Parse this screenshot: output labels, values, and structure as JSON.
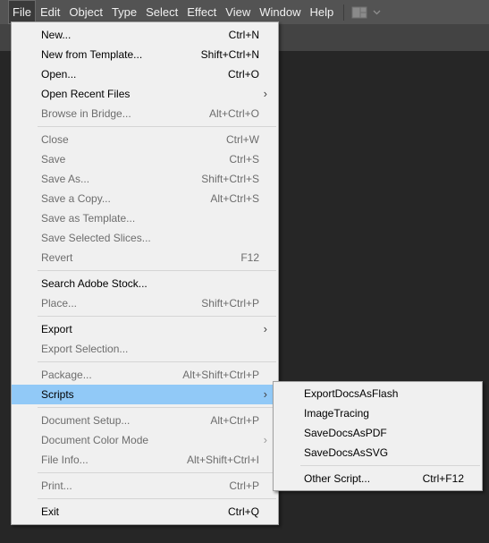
{
  "menubar": {
    "items": [
      "File",
      "Edit",
      "Object",
      "Type",
      "Select",
      "Effect",
      "View",
      "Window",
      "Help"
    ]
  },
  "workspace_icon": "workspace-switcher-icon",
  "file_menu": {
    "items": [
      {
        "label": "New...",
        "shortcut": "Ctrl+N"
      },
      {
        "label": "New from Template...",
        "shortcut": "Shift+Ctrl+N"
      },
      {
        "label": "Open...",
        "shortcut": "Ctrl+O"
      },
      {
        "label": "Open Recent Files",
        "shortcut": ""
      },
      {
        "label": "Browse in Bridge...",
        "shortcut": "Alt+Ctrl+O"
      },
      {
        "label": "Close",
        "shortcut": "Ctrl+W"
      },
      {
        "label": "Save",
        "shortcut": "Ctrl+S"
      },
      {
        "label": "Save As...",
        "shortcut": "Shift+Ctrl+S"
      },
      {
        "label": "Save a Copy...",
        "shortcut": "Alt+Ctrl+S"
      },
      {
        "label": "Save as Template...",
        "shortcut": ""
      },
      {
        "label": "Save Selected Slices...",
        "shortcut": ""
      },
      {
        "label": "Revert",
        "shortcut": "F12"
      },
      {
        "label": "Search Adobe Stock...",
        "shortcut": ""
      },
      {
        "label": "Place...",
        "shortcut": "Shift+Ctrl+P"
      },
      {
        "label": "Export",
        "shortcut": ""
      },
      {
        "label": "Export Selection...",
        "shortcut": ""
      },
      {
        "label": "Package...",
        "shortcut": "Alt+Shift+Ctrl+P"
      },
      {
        "label": "Scripts",
        "shortcut": ""
      },
      {
        "label": "Document Setup...",
        "shortcut": "Alt+Ctrl+P"
      },
      {
        "label": "Document Color Mode",
        "shortcut": ""
      },
      {
        "label": "File Info...",
        "shortcut": "Alt+Shift+Ctrl+I"
      },
      {
        "label": "Print...",
        "shortcut": "Ctrl+P"
      },
      {
        "label": "Exit",
        "shortcut": "Ctrl+Q"
      }
    ]
  },
  "scripts_menu": {
    "items": [
      {
        "label": "ExportDocsAsFlash",
        "shortcut": ""
      },
      {
        "label": "ImageTracing",
        "shortcut": ""
      },
      {
        "label": "SaveDocsAsPDF",
        "shortcut": ""
      },
      {
        "label": "SaveDocsAsSVG",
        "shortcut": ""
      },
      {
        "label": "Other Script...",
        "shortcut": "Ctrl+F12"
      }
    ]
  },
  "colors": {
    "menubar_bg": "#535353",
    "canvas_bg": "#262626",
    "menu_bg": "#f0f0f0",
    "highlight": "#91c9f7",
    "disabled_text": "#6d6d6d"
  }
}
